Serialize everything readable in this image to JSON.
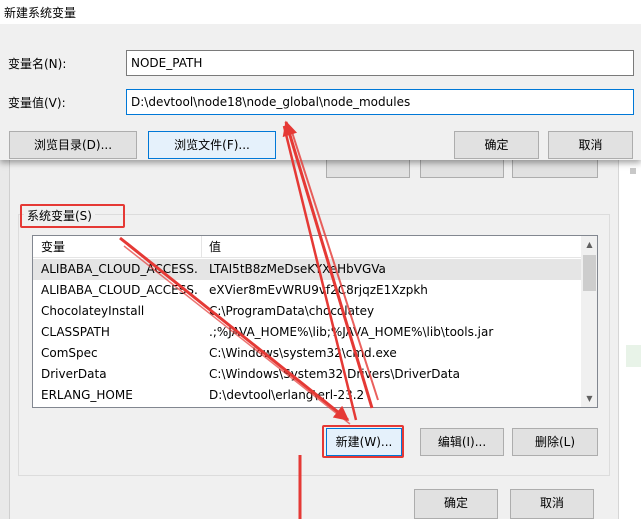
{
  "dialog": {
    "title": "新建系统变量",
    "var_name_label": "变量名(N):",
    "var_name_value": "NODE_PATH",
    "var_value_label": "变量值(V):",
    "var_value_value": "D:\\devtool\\node18\\node_global\\node_modules",
    "browse_dir_label": "浏览目录(D)...",
    "browse_file_label": "浏览文件(F)...",
    "ok_label": "确定",
    "cancel_label": "取消"
  },
  "system_vars": {
    "group_label": "系统变量(S)",
    "columns": [
      "变量",
      "值"
    ],
    "rows": [
      {
        "name": "ALIBABA_CLOUD_ACCESS...",
        "value": "LTAI5tB8zMeDseKYXeHbVGVa"
      },
      {
        "name": "ALIBABA_CLOUD_ACCESS...",
        "value": "eXVier8mEvWRU9vf2C8rjqzE1Xzpkh"
      },
      {
        "name": "ChocolateyInstall",
        "value": "C:\\ProgramData\\chocolatey"
      },
      {
        "name": "CLASSPATH",
        "value": ".;%JAVA_HOME%\\lib;%JAVA_HOME%\\lib\\tools.jar"
      },
      {
        "name": "ComSpec",
        "value": "C:\\Windows\\system32\\cmd.exe"
      },
      {
        "name": "DriverData",
        "value": "C:\\Windows\\System32\\Drivers\\DriverData"
      },
      {
        "name": "ERLANG_HOME",
        "value": "D:\\devtool\\erlang\\erl-23.2"
      }
    ],
    "new_label": "新建(W)...",
    "edit_label": "编辑(I)...",
    "delete_label": "删除(L)"
  },
  "footer": {
    "ok_label": "确定",
    "cancel_label": "取消"
  },
  "colors": {
    "annotation": "#e53935",
    "focus": "#0078d7"
  }
}
